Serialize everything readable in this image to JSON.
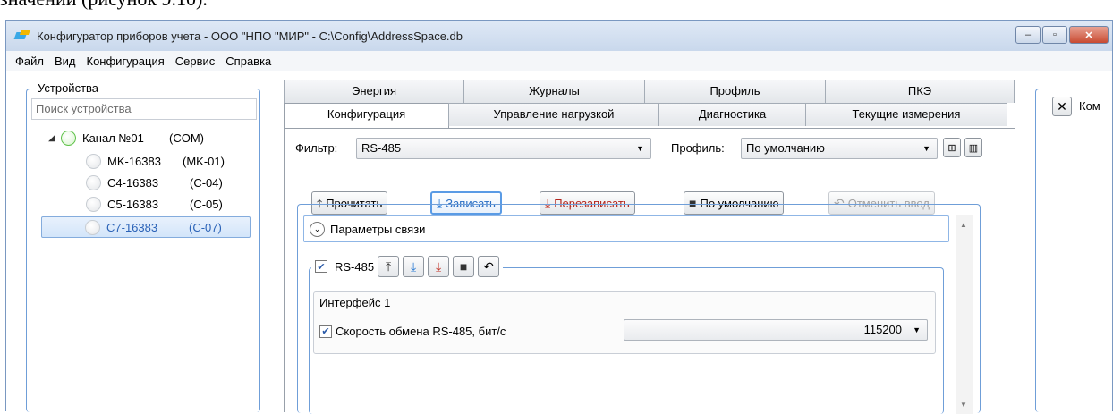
{
  "page": {
    "caption": "значений (рисунок 9.10)."
  },
  "window": {
    "title": "Конфигуратор приборов учета - ООО \"НПО \"МИР\" - C:\\Config\\AddressSpace.db",
    "min": "–",
    "max": "▫",
    "close": "✕"
  },
  "menu": [
    "Файл",
    "Вид",
    "Конфигурация",
    "Сервис",
    "Справка"
  ],
  "devices": {
    "legend": "Устройства",
    "search_placeholder": "Поиск устройства",
    "channel": {
      "name": "Канал №01",
      "type": "(COM)"
    },
    "items": [
      {
        "name": "MK-16383",
        "code": "(MK-01)"
      },
      {
        "name": "C4-16383",
        "code": "(C-04)"
      },
      {
        "name": "C5-16383",
        "code": "(C-05)"
      },
      {
        "name": "C7-16383",
        "code": "(C-07)"
      }
    ]
  },
  "tabs": {
    "row1": [
      "Энергия",
      "Журналы",
      "Профиль",
      "ПКЭ"
    ],
    "row2": [
      "Конфигурация",
      "Управление нагрузкой",
      "Диагностика",
      "Текущие измерения"
    ],
    "active": "Конфигурация"
  },
  "filter": {
    "label": "Фильтр:",
    "value": "RS-485"
  },
  "profile": {
    "label": "Профиль:",
    "value": "По умолчанию"
  },
  "actions": {
    "read": "Прочитать",
    "write": "Записать",
    "overwrite": "Перезаписать",
    "defaults": "По умолчанию",
    "undo": "Отменить ввод"
  },
  "section": {
    "title": "Параметры связи"
  },
  "rs485": {
    "label": "RS-485",
    "interface_label": "Интерфейс 1",
    "speed_label": "Скорость обмена RS-485, бит/с",
    "speed_value": "115200"
  },
  "right_panel": {
    "label": "Ком"
  },
  "icons": {
    "read": "upload-icon",
    "write": "download-icon",
    "overwrite": "download-red-icon",
    "defaults": "cube-icon",
    "undo": "undo-icon",
    "add": "add-icon",
    "delete": "trash-icon"
  }
}
